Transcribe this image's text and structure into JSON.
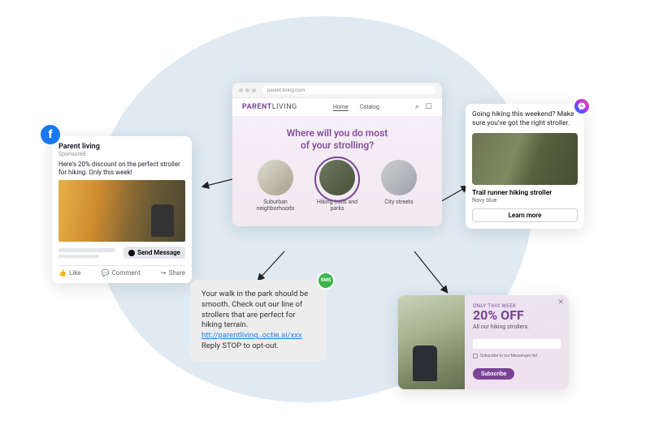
{
  "browser": {
    "url": "parent-living.com",
    "brand": {
      "p1": "PARENT",
      "p2": "LIVING"
    },
    "nav": {
      "home": "Home",
      "catalog": "Catalog"
    },
    "icons": {
      "search": "search-icon",
      "bag": "bag-icon"
    },
    "quiz": {
      "heading_line1": "Where will you do most",
      "heading_line2": "of your strolling?",
      "options": [
        "Suburban neighborhoods",
        "Hiking trails and parks",
        "City streets"
      ]
    }
  },
  "facebook": {
    "page_name": "Parent living",
    "sponsored": "Sponsored",
    "copy": "Here's 20% discount on the perfect stroller for hiking. Only this week!",
    "cta": "Send Message",
    "actions": {
      "like": "Like",
      "comment": "Comment",
      "share": "Share"
    }
  },
  "sms": {
    "badge": "SMS",
    "body_parts": {
      "t1": "Your walk in the park should be smooth. Check out our line of strollers that are perfect for hiking terrain.",
      "link": "htt://parentliving..octie.ai/xxx",
      "t2": "Reply STOP to opt-out."
    }
  },
  "messenger": {
    "text": "Going hiking this weekend? Make sure you've got the right stroller.",
    "product": "Trail runner hiking stroller",
    "variant": "Navy blue",
    "cta": "Learn more"
  },
  "promo": {
    "kicker": "ONLY THIS WEEK",
    "headline": "20% OFF",
    "sub": "All our hiking strollers.",
    "checkbox": "Subscribe to our Messenger list",
    "cta": "Subscribe"
  }
}
